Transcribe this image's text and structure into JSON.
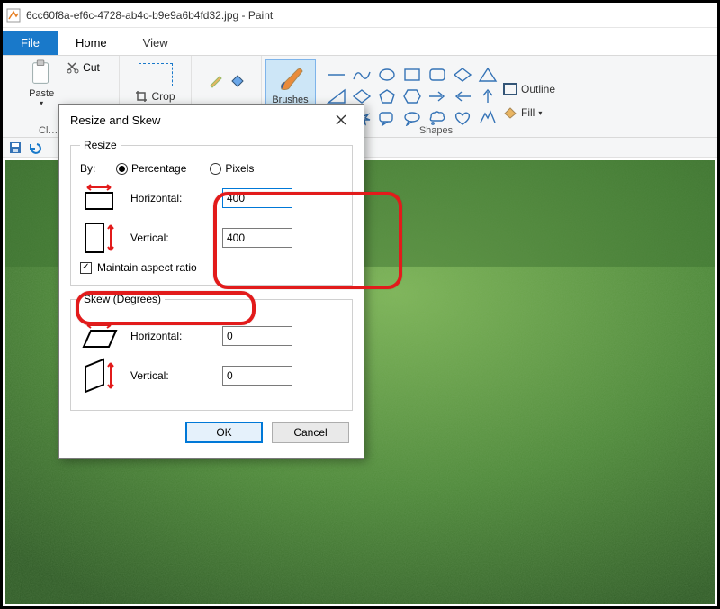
{
  "window": {
    "title": "6cc60f8a-ef6c-4728-ab4c-b9e9a6b4fd32.jpg - Paint"
  },
  "tabs": {
    "file": "File",
    "home": "Home",
    "view": "View"
  },
  "ribbon": {
    "clipboard_label": "Clipboard",
    "paste": "Paste",
    "cut": "Cut",
    "crop": "Crop",
    "brushes": "Brushes",
    "shapes_label": "Shapes",
    "outline": "Outline",
    "fill": "Fill"
  },
  "dialog": {
    "title": "Resize and Skew",
    "resize_legend": "Resize",
    "by_label": "By:",
    "percentage": "Percentage",
    "pixels": "Pixels",
    "horizontal": "Horizontal:",
    "vertical": "Vertical:",
    "h_value": "400",
    "v_value": "400",
    "maintain": "Maintain aspect ratio",
    "skew_legend": "Skew (Degrees)",
    "skew_h": "Horizontal:",
    "skew_v": "Vertical:",
    "skew_h_value": "0",
    "skew_v_value": "0",
    "ok": "OK",
    "cancel": "Cancel"
  }
}
